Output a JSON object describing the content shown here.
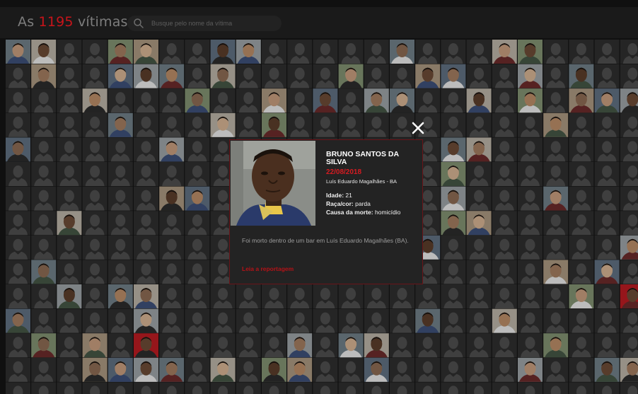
{
  "header": {
    "brand_prefix": "As",
    "victim_count": "1195",
    "brand_suffix": "vítimas",
    "search_placeholder": "Busque pelo nome da vítima",
    "search_value": ""
  },
  "modal": {
    "name": "BRUNO SANTOS DA SILVA",
    "date": "22/08/2018",
    "place": "Luís Eduardo Magalhães - BA",
    "age_label": "Idade:",
    "age_value": "21",
    "race_label": "Raça/cor:",
    "race_value": "parda",
    "cause_label": "Causa da morte:",
    "cause_value": "homicídio",
    "description": "Foi morto dentro de um bar em Luís Eduardo Magalhães (BA).",
    "link_label": "Leia a reportagem",
    "close_icon": "close-icon"
  },
  "colors": {
    "background": "#141414",
    "accent": "#c8141a",
    "placeholder_tile": "#2e2e2e",
    "silhouette": "#4d4d4d",
    "modal_bg": "#232323",
    "modal_border": "#6a1418"
  },
  "grid": {
    "columns": 25,
    "rows": 15,
    "photo_tiles": [
      [
        0,
        0
      ],
      [
        0,
        1
      ],
      [
        0,
        4
      ],
      [
        0,
        5
      ],
      [
        0,
        8
      ],
      [
        0,
        9
      ],
      [
        0,
        15
      ],
      [
        0,
        19
      ],
      [
        0,
        20
      ],
      [
        1,
        1
      ],
      [
        1,
        4
      ],
      [
        1,
        5
      ],
      [
        1,
        6
      ],
      [
        1,
        8
      ],
      [
        1,
        13
      ],
      [
        1,
        16
      ],
      [
        1,
        17
      ],
      [
        1,
        20
      ],
      [
        1,
        22
      ],
      [
        2,
        3
      ],
      [
        2,
        7
      ],
      [
        2,
        10
      ],
      [
        2,
        12
      ],
      [
        2,
        14
      ],
      [
        2,
        15
      ],
      [
        2,
        18
      ],
      [
        2,
        20
      ],
      [
        2,
        22
      ],
      [
        2,
        23
      ],
      [
        2,
        24
      ],
      [
        3,
        4
      ],
      [
        3,
        8
      ],
      [
        3,
        10
      ],
      [
        3,
        21
      ],
      [
        4,
        0
      ],
      [
        4,
        6
      ],
      [
        4,
        17
      ],
      [
        4,
        18
      ],
      [
        5,
        17
      ],
      [
        6,
        6
      ],
      [
        6,
        7
      ],
      [
        6,
        17
      ],
      [
        6,
        21
      ],
      [
        7,
        2
      ],
      [
        7,
        17
      ],
      [
        7,
        18
      ],
      [
        8,
        16
      ],
      [
        8,
        24
      ],
      [
        9,
        1
      ],
      [
        9,
        9
      ],
      [
        9,
        14
      ],
      [
        9,
        21
      ],
      [
        9,
        23
      ],
      [
        10,
        2
      ],
      [
        10,
        4
      ],
      [
        10,
        5
      ],
      [
        10,
        22
      ],
      [
        10,
        24
      ],
      [
        11,
        0
      ],
      [
        11,
        5
      ],
      [
        11,
        16
      ],
      [
        11,
        19
      ],
      [
        12,
        1
      ],
      [
        12,
        3
      ],
      [
        12,
        5
      ],
      [
        12,
        11
      ],
      [
        12,
        13
      ],
      [
        12,
        14
      ],
      [
        12,
        21
      ],
      [
        13,
        3
      ],
      [
        13,
        4
      ],
      [
        13,
        5
      ],
      [
        13,
        6
      ],
      [
        13,
        8
      ],
      [
        13,
        10
      ],
      [
        13,
        11
      ],
      [
        13,
        14
      ],
      [
        13,
        20
      ],
      [
        13,
        23
      ],
      [
        13,
        24
      ]
    ],
    "red_tiles": [
      [
        12,
        5
      ],
      [
        10,
        24
      ],
      [
        13,
        22
      ]
    ]
  }
}
